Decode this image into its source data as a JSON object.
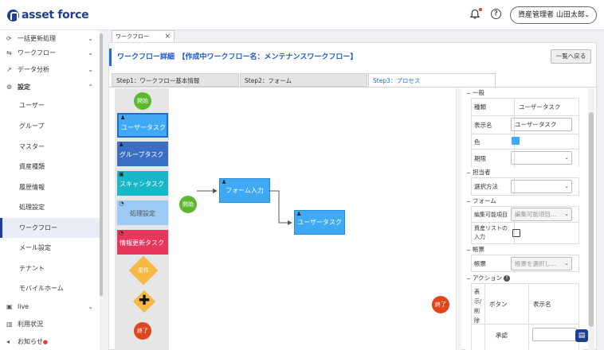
{
  "app": {
    "logo": "asset force"
  },
  "header": {
    "user": "資産管理者 山田太郎"
  },
  "sidebar": {
    "items": [
      {
        "label": "一括更新処理"
      },
      {
        "label": "ワークフロー"
      },
      {
        "label": "データ分析"
      },
      {
        "label": "設定"
      }
    ],
    "settings": [
      {
        "label": "ユーザー"
      },
      {
        "label": "グループ"
      },
      {
        "label": "マスター"
      },
      {
        "label": "資産種類"
      },
      {
        "label": "履歴情報"
      },
      {
        "label": "処理設定"
      },
      {
        "label": "ワークフロー"
      },
      {
        "label": "メール設定"
      },
      {
        "label": "テナント"
      },
      {
        "label": "モバイルホーム"
      }
    ],
    "bottom": [
      {
        "label": "live"
      },
      {
        "label": "利用状況"
      },
      {
        "label": "お知らせ"
      }
    ]
  },
  "doc_tab": {
    "label": "ワークフロー",
    "close": "×"
  },
  "page": {
    "title": "ワークフロー詳細　【作成中ワークフロー名：メンテナンスワークフロー】",
    "back_button": "一覧へ戻る"
  },
  "steps": [
    {
      "label": "Step1：ワークフロー基本情報"
    },
    {
      "label": "Step2：フォーム"
    },
    {
      "label": "Step3：プロセス"
    }
  ],
  "palette": {
    "start": "開始",
    "tasks": [
      {
        "label": "ユーザータスク",
        "color": "#3fa9f5"
      },
      {
        "label": "グループタスク",
        "color": "#3a6fc4"
      },
      {
        "label": "スキャンタスク",
        "color": "#19b5c9"
      },
      {
        "label": "処理設定",
        "color": "#9ccaf5"
      },
      {
        "label": "情報更新タスク",
        "color": "#e8365d"
      }
    ],
    "condition": "条件",
    "end": "終了"
  },
  "canvas": {
    "start": "開始",
    "task1": "フォーム入力",
    "task2": "ユーザータスク",
    "end": "終了"
  },
  "properties": {
    "general": {
      "heading": "一般",
      "type_label": "種類",
      "type_value": "ユーザータスク",
      "display_label": "表示名",
      "display_value": "ユーザータスク",
      "color_label": "色",
      "color_value": "#3fa9f5",
      "deadline_label": "期限"
    },
    "assignee": {
      "heading": "担当者",
      "method_label": "選択方法"
    },
    "form": {
      "heading": "フォーム",
      "editable_label": "編集可能項目",
      "editable_placeholder": "編集可能項目...",
      "asset_list_label": "資産リストの入力"
    },
    "forms2": {
      "heading": "帳票",
      "label": "帳票",
      "placeholder": "帳票を選択し..."
    },
    "action": {
      "heading": "アクション",
      "col1": "表示/削除",
      "col2": "ボタン",
      "col3": "表示名",
      "row1": "承認"
    }
  }
}
